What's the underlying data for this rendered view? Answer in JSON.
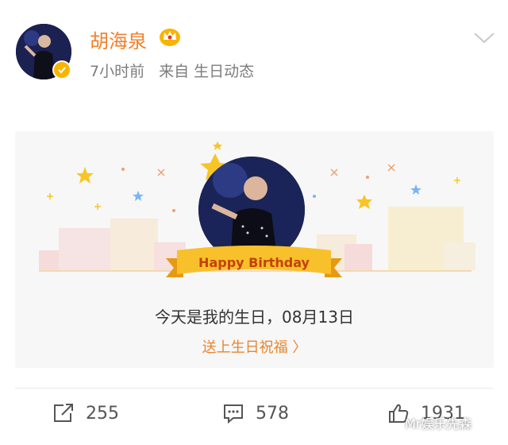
{
  "post": {
    "author": "胡海泉",
    "time_ago": "7小时前",
    "source": "来自 生日动态",
    "icons": {
      "verified": "verified-badge-icon",
      "crown": "member-crown-icon",
      "menu": "chevron-down-icon"
    },
    "brand_color": "#f2812d"
  },
  "card": {
    "banner": "Happy Birthday",
    "message": "今天是我的生日，08月13日",
    "link": "送上生日祝福 〉"
  },
  "actions": {
    "share_count": "255",
    "comment_count": "578",
    "like_count": "1931"
  },
  "watermark": "Mr娱乐先森"
}
